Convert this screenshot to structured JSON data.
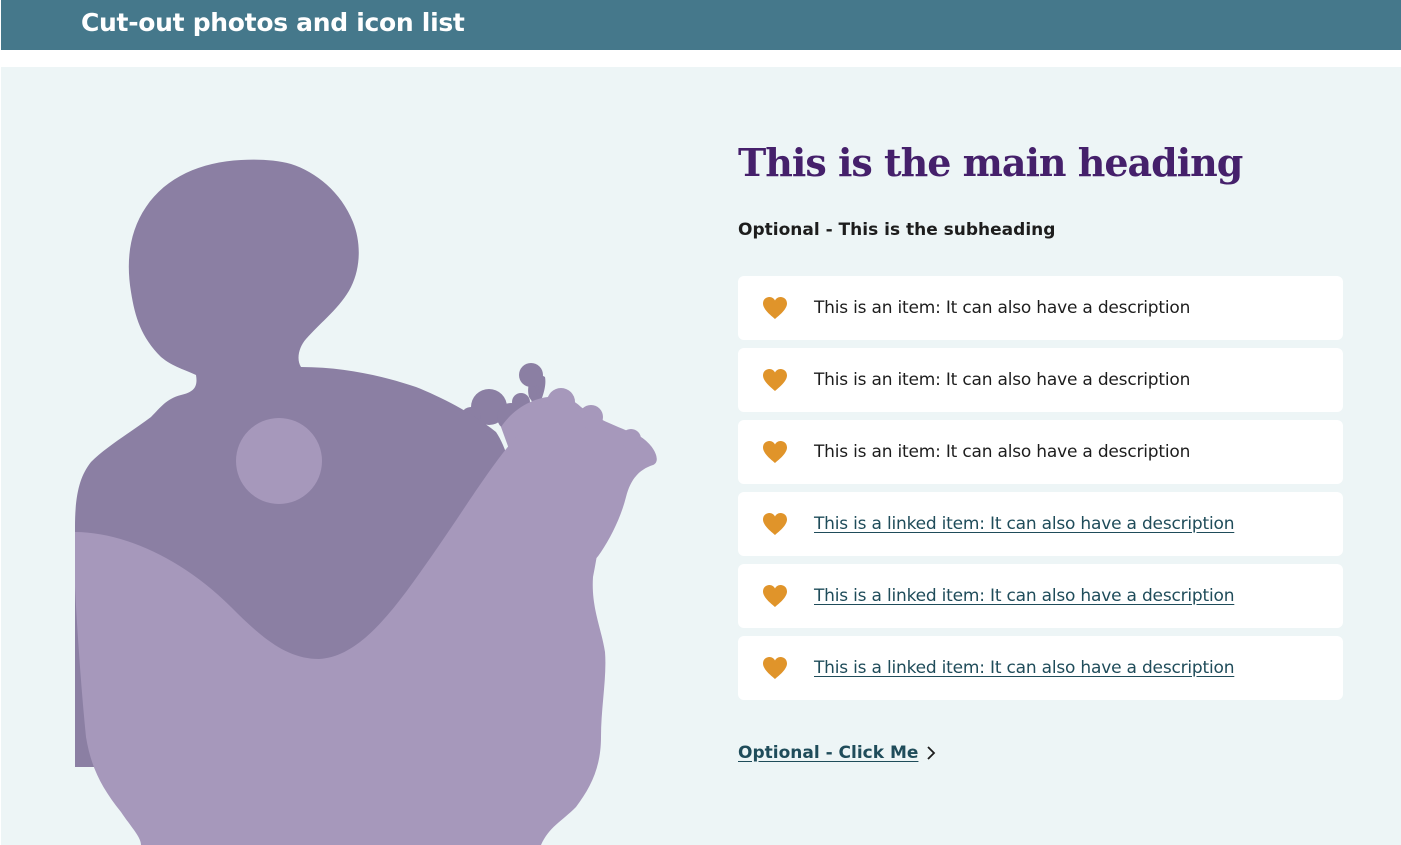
{
  "banner": {
    "title": "Cut-out photos and icon list"
  },
  "content": {
    "heading": "This is the main heading",
    "subheading": "Optional - This is the subheading",
    "items": [
      {
        "text": "This is an item: It can also have a description",
        "linked": false,
        "icon": "heart-icon"
      },
      {
        "text": "This is an item: It can also have a description",
        "linked": false,
        "icon": "heart-icon"
      },
      {
        "text": "This is an item: It can also have a description",
        "linked": false,
        "icon": "heart-icon"
      },
      {
        "text": "This is a linked item: It can also have a description",
        "linked": true,
        "icon": "heart-icon"
      },
      {
        "text": "This is a linked item: It can also have a description",
        "linked": true,
        "icon": "heart-icon"
      },
      {
        "text": "This is a linked item: It can also have a description",
        "linked": true,
        "icon": "heart-icon"
      }
    ],
    "cta": {
      "label": "Optional - Click Me",
      "icon": "chevron-right-icon"
    }
  },
  "colors": {
    "banner_bg": "#45788b",
    "section_bg": "#edf5f6",
    "heading": "#45206b",
    "link": "#1f4c5a",
    "icon": "#e0942a",
    "silhouette_dark": "#8b7fa3",
    "silhouette_light": "#a698bb"
  }
}
